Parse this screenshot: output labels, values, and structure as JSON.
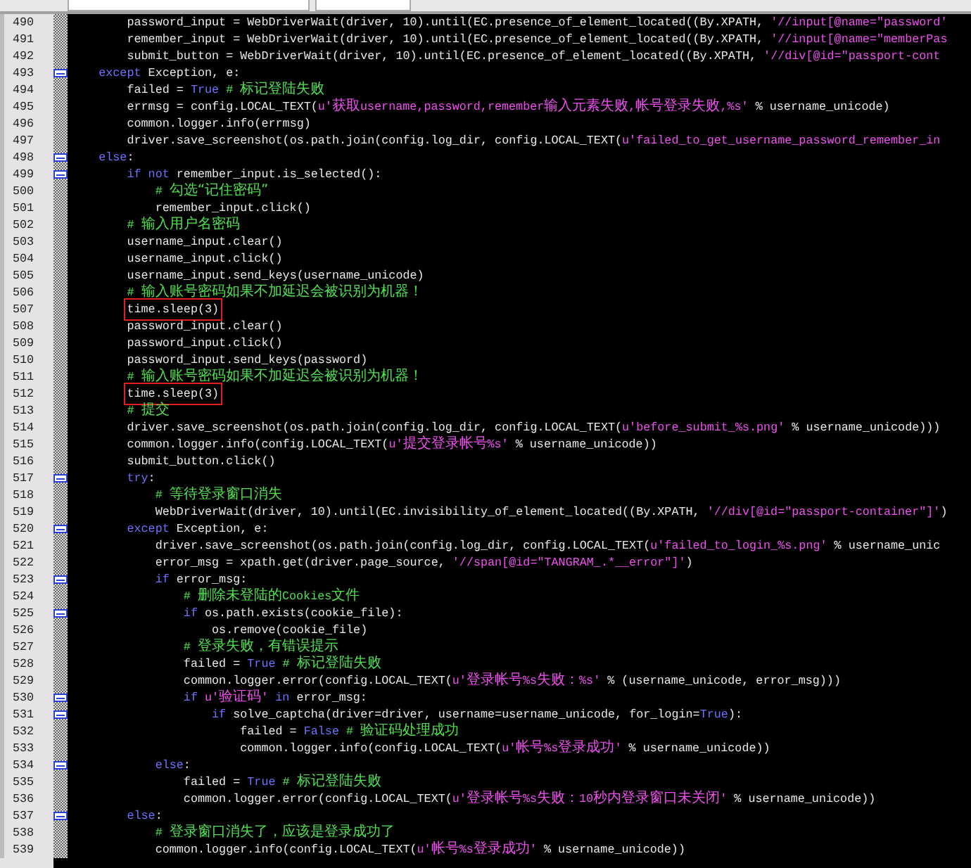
{
  "lines": [
    {
      "number": "490",
      "fold": false,
      "boxed": false,
      "segments": [
        {
          "kind": "code",
          "text": "        password_input = WebDriverWait(driver, 10).until(EC.presence_of_element_located((By.XPATH, "
        },
        {
          "kind": "string",
          "text": "'//input[@name=\"password'"
        }
      ]
    },
    {
      "number": "491",
      "fold": false,
      "boxed": false,
      "segments": [
        {
          "kind": "code",
          "text": "        remember_input = WebDriverWait(driver, 10).until(EC.presence_of_element_located((By.XPATH, "
        },
        {
          "kind": "string",
          "text": "'//input[@name=\"memberPas"
        }
      ]
    },
    {
      "number": "492",
      "fold": false,
      "boxed": false,
      "segments": [
        {
          "kind": "code",
          "text": "        submit_button = WebDriverWait(driver, 10).until(EC.presence_of_element_located((By.XPATH, "
        },
        {
          "kind": "string",
          "text": "'//div[@id=\"passport-cont"
        }
      ]
    },
    {
      "number": "493",
      "fold": true,
      "boxed": false,
      "segments": [
        {
          "kind": "keyword",
          "text": "    except"
        },
        {
          "kind": "code",
          "text": " Exception, e:"
        }
      ]
    },
    {
      "number": "494",
      "fold": false,
      "boxed": false,
      "segments": [
        {
          "kind": "code",
          "text": "        failed = "
        },
        {
          "kind": "keyword",
          "text": "True"
        },
        {
          "kind": "comment",
          "text": " # 标记登陆失败"
        }
      ]
    },
    {
      "number": "495",
      "fold": false,
      "boxed": false,
      "segments": [
        {
          "kind": "code",
          "text": "        errmsg = config.LOCAL_TEXT("
        },
        {
          "kind": "string",
          "text": "u'获取username,password,remember输入元素失败,帐号登录失败,%s'"
        },
        {
          "kind": "code",
          "text": " % username_unicode)"
        }
      ]
    },
    {
      "number": "496",
      "fold": false,
      "boxed": false,
      "segments": [
        {
          "kind": "code",
          "text": "        common.logger.info(errmsg)"
        }
      ]
    },
    {
      "number": "497",
      "fold": false,
      "boxed": false,
      "segments": [
        {
          "kind": "code",
          "text": "        driver.save_screenshot(os.path.join(config.log_dir, config.LOCAL_TEXT("
        },
        {
          "kind": "string",
          "text": "u'failed_to_get_username_password_remember_in"
        }
      ]
    },
    {
      "number": "498",
      "fold": true,
      "boxed": false,
      "segments": [
        {
          "kind": "keyword",
          "text": "    else"
        },
        {
          "kind": "code",
          "text": ":"
        }
      ]
    },
    {
      "number": "499",
      "fold": true,
      "boxed": false,
      "segments": [
        {
          "kind": "keyword",
          "text": "        if not"
        },
        {
          "kind": "code",
          "text": " remember_input.is_selected():"
        }
      ]
    },
    {
      "number": "500",
      "fold": false,
      "boxed": false,
      "segments": [
        {
          "kind": "comment",
          "text": "            # 勾选“记住密码”"
        }
      ]
    },
    {
      "number": "501",
      "fold": false,
      "boxed": false,
      "segments": [
        {
          "kind": "code",
          "text": "            remember_input.click()"
        }
      ]
    },
    {
      "number": "502",
      "fold": false,
      "boxed": false,
      "segments": [
        {
          "kind": "comment",
          "text": "        # 输入用户名密码"
        }
      ]
    },
    {
      "number": "503",
      "fold": false,
      "boxed": false,
      "segments": [
        {
          "kind": "code",
          "text": "        username_input.clear()"
        }
      ]
    },
    {
      "number": "504",
      "fold": false,
      "boxed": false,
      "segments": [
        {
          "kind": "code",
          "text": "        username_input.click()"
        }
      ]
    },
    {
      "number": "505",
      "fold": false,
      "boxed": false,
      "segments": [
        {
          "kind": "code",
          "text": "        username_input.send_keys(username_unicode)"
        }
      ]
    },
    {
      "number": "506",
      "fold": false,
      "boxed": false,
      "segments": [
        {
          "kind": "comment",
          "text": "        # 输入账号密码如果不加延迟会被识别为机器！"
        }
      ]
    },
    {
      "number": "507",
      "fold": false,
      "boxed": true,
      "segments": [
        {
          "kind": "code",
          "text": "        time.sleep(3)"
        }
      ]
    },
    {
      "number": "508",
      "fold": false,
      "boxed": false,
      "segments": [
        {
          "kind": "code",
          "text": "        password_input.clear()"
        }
      ]
    },
    {
      "number": "509",
      "fold": false,
      "boxed": false,
      "segments": [
        {
          "kind": "code",
          "text": "        password_input.click()"
        }
      ]
    },
    {
      "number": "510",
      "fold": false,
      "boxed": false,
      "segments": [
        {
          "kind": "code",
          "text": "        password_input.send_keys(password)"
        }
      ]
    },
    {
      "number": "511",
      "fold": false,
      "boxed": false,
      "segments": [
        {
          "kind": "comment",
          "text": "        # 输入账号密码如果不加延迟会被识别为机器！"
        }
      ]
    },
    {
      "number": "512",
      "fold": false,
      "boxed": true,
      "segments": [
        {
          "kind": "code",
          "text": "        time.sleep(3)"
        }
      ]
    },
    {
      "number": "513",
      "fold": false,
      "boxed": false,
      "segments": [
        {
          "kind": "comment",
          "text": "        # 提交"
        }
      ]
    },
    {
      "number": "514",
      "fold": false,
      "boxed": false,
      "segments": [
        {
          "kind": "code",
          "text": "        driver.save_screenshot(os.path.join(config.log_dir, config.LOCAL_TEXT("
        },
        {
          "kind": "string",
          "text": "u'before_submit_%s.png'"
        },
        {
          "kind": "code",
          "text": " % username_unicode)))"
        }
      ]
    },
    {
      "number": "515",
      "fold": false,
      "boxed": false,
      "segments": [
        {
          "kind": "code",
          "text": "        common.logger.info(config.LOCAL_TEXT("
        },
        {
          "kind": "string",
          "text": "u'提交登录帐号%s'"
        },
        {
          "kind": "code",
          "text": " % username_unicode))"
        }
      ]
    },
    {
      "number": "516",
      "fold": false,
      "boxed": false,
      "segments": [
        {
          "kind": "code",
          "text": "        submit_button.click()"
        }
      ]
    },
    {
      "number": "517",
      "fold": true,
      "boxed": false,
      "segments": [
        {
          "kind": "keyword",
          "text": "        try"
        },
        {
          "kind": "code",
          "text": ":"
        }
      ]
    },
    {
      "number": "518",
      "fold": false,
      "boxed": false,
      "segments": [
        {
          "kind": "comment",
          "text": "            # 等待登录窗口消失"
        }
      ]
    },
    {
      "number": "519",
      "fold": false,
      "boxed": false,
      "segments": [
        {
          "kind": "code",
          "text": "            WebDriverWait(driver, 10).until(EC.invisibility_of_element_located((By.XPATH, "
        },
        {
          "kind": "string",
          "text": "'//div[@id=\"passport-container\"]'"
        },
        {
          "kind": "code",
          "text": ")"
        }
      ]
    },
    {
      "number": "520",
      "fold": true,
      "boxed": false,
      "segments": [
        {
          "kind": "keyword",
          "text": "        except"
        },
        {
          "kind": "code",
          "text": " Exception, e:"
        }
      ]
    },
    {
      "number": "521",
      "fold": false,
      "boxed": false,
      "segments": [
        {
          "kind": "code",
          "text": "            driver.save_screenshot(os.path.join(config.log_dir, config.LOCAL_TEXT("
        },
        {
          "kind": "string",
          "text": "u'failed_to_login_%s.png'"
        },
        {
          "kind": "code",
          "text": " % username_unic"
        }
      ]
    },
    {
      "number": "522",
      "fold": false,
      "boxed": false,
      "segments": [
        {
          "kind": "code",
          "text": "            error_msg = xpath.get(driver.page_source, "
        },
        {
          "kind": "string",
          "text": "'//span[@id=\"TANGRAM_.*__error\"]'"
        },
        {
          "kind": "code",
          "text": ")"
        }
      ]
    },
    {
      "number": "523",
      "fold": true,
      "boxed": false,
      "segments": [
        {
          "kind": "keyword",
          "text": "            if"
        },
        {
          "kind": "code",
          "text": " error_msg:"
        }
      ]
    },
    {
      "number": "524",
      "fold": false,
      "boxed": false,
      "segments": [
        {
          "kind": "comment",
          "text": "                # 删除未登陆的Cookies文件"
        }
      ]
    },
    {
      "number": "525",
      "fold": true,
      "boxed": false,
      "segments": [
        {
          "kind": "keyword",
          "text": "                if"
        },
        {
          "kind": "code",
          "text": " os.path.exists(cookie_file):"
        }
      ]
    },
    {
      "number": "526",
      "fold": false,
      "boxed": false,
      "segments": [
        {
          "kind": "code",
          "text": "                    os.remove(cookie_file)"
        }
      ]
    },
    {
      "number": "527",
      "fold": false,
      "boxed": false,
      "segments": [
        {
          "kind": "comment",
          "text": "                # 登录失败，有错误提示"
        }
      ]
    },
    {
      "number": "528",
      "fold": false,
      "boxed": false,
      "segments": [
        {
          "kind": "code",
          "text": "                failed = "
        },
        {
          "kind": "keyword",
          "text": "True"
        },
        {
          "kind": "comment",
          "text": " # 标记登陆失败"
        }
      ]
    },
    {
      "number": "529",
      "fold": false,
      "boxed": false,
      "segments": [
        {
          "kind": "code",
          "text": "                common.logger.error(config.LOCAL_TEXT("
        },
        {
          "kind": "string",
          "text": "u'登录帐号%s失败：%s'"
        },
        {
          "kind": "code",
          "text": " % (username_unicode, error_msg)))"
        }
      ]
    },
    {
      "number": "530",
      "fold": true,
      "boxed": false,
      "segments": [
        {
          "kind": "keyword",
          "text": "                if"
        },
        {
          "kind": "string",
          "text": " u'验证码'"
        },
        {
          "kind": "keyword",
          "text": " in"
        },
        {
          "kind": "code",
          "text": " error_msg:"
        }
      ]
    },
    {
      "number": "531",
      "fold": true,
      "boxed": false,
      "segments": [
        {
          "kind": "keyword",
          "text": "                    if"
        },
        {
          "kind": "code",
          "text": " solve_captcha(driver=driver, username=username_unicode, for_login="
        },
        {
          "kind": "keyword",
          "text": "True"
        },
        {
          "kind": "code",
          "text": "):"
        }
      ]
    },
    {
      "number": "532",
      "fold": false,
      "boxed": false,
      "segments": [
        {
          "kind": "code",
          "text": "                        failed = "
        },
        {
          "kind": "keyword",
          "text": "False"
        },
        {
          "kind": "comment",
          "text": " # 验证码处理成功"
        }
      ]
    },
    {
      "number": "533",
      "fold": false,
      "boxed": false,
      "segments": [
        {
          "kind": "code",
          "text": "                        common.logger.info(config.LOCAL_TEXT("
        },
        {
          "kind": "string",
          "text": "u'帐号%s登录成功'"
        },
        {
          "kind": "code",
          "text": " % username_unicode))"
        }
      ]
    },
    {
      "number": "534",
      "fold": true,
      "boxed": false,
      "segments": [
        {
          "kind": "keyword",
          "text": "            else"
        },
        {
          "kind": "code",
          "text": ":"
        }
      ]
    },
    {
      "number": "535",
      "fold": false,
      "boxed": false,
      "segments": [
        {
          "kind": "code",
          "text": "                failed = "
        },
        {
          "kind": "keyword",
          "text": "True"
        },
        {
          "kind": "comment",
          "text": " # 标记登陆失败"
        }
      ]
    },
    {
      "number": "536",
      "fold": false,
      "boxed": false,
      "segments": [
        {
          "kind": "code",
          "text": "                common.logger.error(config.LOCAL_TEXT("
        },
        {
          "kind": "string",
          "text": "u'登录帐号%s失败：10秒内登录窗口未关闭'"
        },
        {
          "kind": "code",
          "text": " % username_unicode))"
        }
      ]
    },
    {
      "number": "537",
      "fold": true,
      "boxed": false,
      "segments": [
        {
          "kind": "keyword",
          "text": "        else"
        },
        {
          "kind": "code",
          "text": ":"
        }
      ]
    },
    {
      "number": "538",
      "fold": false,
      "boxed": false,
      "segments": [
        {
          "kind": "comment",
          "text": "            # 登录窗口消失了，应该是登录成功了"
        }
      ]
    },
    {
      "number": "539",
      "fold": false,
      "boxed": false,
      "segments": [
        {
          "kind": "code",
          "text": "            common.logger.info(config.LOCAL_TEXT("
        },
        {
          "kind": "string",
          "text": "u'帐号%s登录成功'"
        },
        {
          "kind": "code",
          "text": " % username_unicode))"
        }
      ]
    }
  ]
}
